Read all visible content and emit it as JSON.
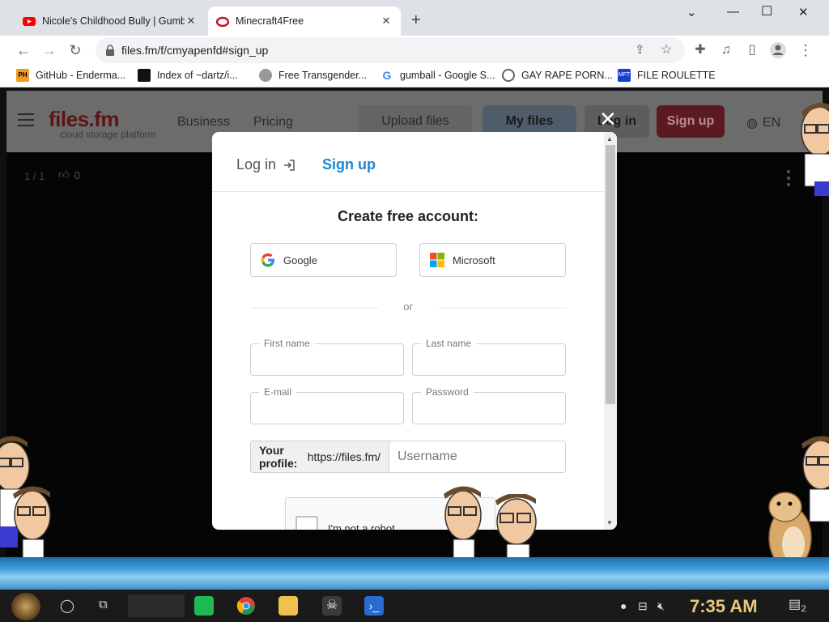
{
  "browser": {
    "tabs": [
      {
        "title": "Nicole's Childhood Bully | Gumb",
        "icon": "youtube-icon",
        "active": false
      },
      {
        "title": "Minecraft4Free",
        "icon": "files-fm-icon",
        "active": true
      }
    ],
    "new_tab": "+",
    "url": "files.fm/f/cmyapenfd#sign_up",
    "bookmarks": [
      {
        "label": "GitHub - Enderma...",
        "icon": "ph-icon"
      },
      {
        "label": "Index of ~dartz/i...",
        "icon": "pixel-icon"
      },
      {
        "label": "Free Transgender...",
        "icon": "hat-icon"
      },
      {
        "label": "gumball - Google S...",
        "icon": "google-icon"
      },
      {
        "label": "GAY RAPE PORN...",
        "icon": "globe-icon"
      },
      {
        "label": "FILE ROULETTE",
        "icon": "mft-icon"
      }
    ]
  },
  "site": {
    "logo": "files.fm",
    "tagline": "cloud storage platform",
    "nav": [
      "Business",
      "Pricing"
    ],
    "upload": "Upload files",
    "my_files": "My files",
    "login": "Log in",
    "signup": "Sign up",
    "lang": "EN",
    "counter": "1 / 1",
    "likes": "0"
  },
  "modal": {
    "close": "✕",
    "tab_login": "Log in",
    "tab_signup": "Sign up",
    "title": "Create free account:",
    "google": "Google",
    "microsoft": "Microsoft",
    "or": "or",
    "first_name": "First name",
    "last_name": "Last name",
    "email": "E-mail",
    "password": "Password",
    "profile_label": "Your profile:",
    "profile_url": "https://files.fm/",
    "username_placeholder": "Username",
    "captcha": "I'm not a robot"
  },
  "taskbar": {
    "time": "7:35 AM",
    "notifications": "2"
  },
  "colors": {
    "accent_blue": "#1b87d4",
    "signup_red": "#c8102e",
    "clock_gold": "#e8c97a"
  }
}
